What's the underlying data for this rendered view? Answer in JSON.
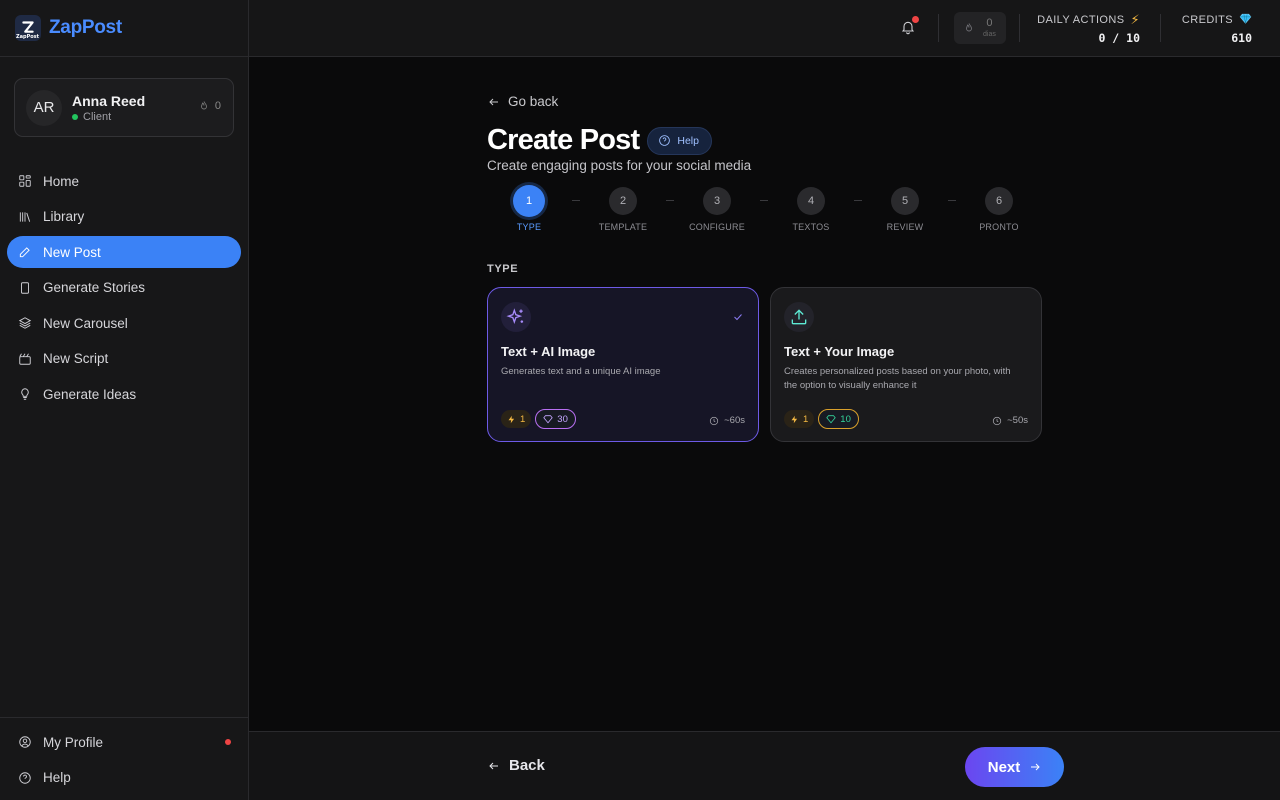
{
  "brand": {
    "name": "ZapPost",
    "logo_mini": "ZapPost",
    "accent": "#4a8cff"
  },
  "user": {
    "initials": "AR",
    "name": "Anna Reed",
    "role": "Client",
    "streak": "0"
  },
  "nav": {
    "items": [
      {
        "label": "Home",
        "icon": "grid-icon"
      },
      {
        "label": "Library",
        "icon": "library-icon"
      },
      {
        "label": "New Post",
        "icon": "pencil-icon",
        "active": true
      },
      {
        "label": "Generate Stories",
        "icon": "phone-icon"
      },
      {
        "label": "New Carousel",
        "icon": "layers-icon"
      },
      {
        "label": "New Script",
        "icon": "clapper-icon"
      },
      {
        "label": "Generate Ideas",
        "icon": "lightbulb-icon"
      }
    ],
    "bottom": [
      {
        "label": "My Profile",
        "icon": "user-circle-icon"
      },
      {
        "label": "Help",
        "icon": "help-circle-icon"
      }
    ]
  },
  "topbar": {
    "streak": {
      "value": "0",
      "label": "dias"
    },
    "daily_actions": {
      "label": "DAILY ACTIONS",
      "icon": "lightning-icon",
      "value": "0 / 10"
    },
    "credits": {
      "label": "CREDITS",
      "icon": "diamond-icon",
      "value": "610"
    }
  },
  "page": {
    "go_back": "Go back",
    "title": "Create Post",
    "help": "Help",
    "subtitle": "Create engaging posts for your social media"
  },
  "steps": [
    {
      "num": "1",
      "label": "TYPE",
      "active": true
    },
    {
      "num": "2",
      "label": "TEMPLATE"
    },
    {
      "num": "3",
      "label": "CONFIGURE"
    },
    {
      "num": "4",
      "label": "TEXTOS"
    },
    {
      "num": "5",
      "label": "REVIEW"
    },
    {
      "num": "6",
      "label": "PRONTO"
    }
  ],
  "section": {
    "label": "TYPE"
  },
  "cards": [
    {
      "title": "Text + AI Image",
      "desc": "Generates text and a unique AI image",
      "energy": "1",
      "credits": "30",
      "time": "~60s",
      "selected": true,
      "icon": "sparkles-icon"
    },
    {
      "title": "Text + Your Image",
      "desc": "Creates personalized posts based on your photo, with the option to visually enhance it",
      "energy": "1",
      "credits": "10",
      "time": "~50s",
      "selected": false,
      "icon": "upload-icon"
    }
  ],
  "footer": {
    "back": "Back",
    "next": "Next"
  },
  "colors": {
    "primary": "#3b82f6",
    "selected_border": "#6d5ae6",
    "danger": "#ef4444",
    "success": "#22c55e"
  }
}
